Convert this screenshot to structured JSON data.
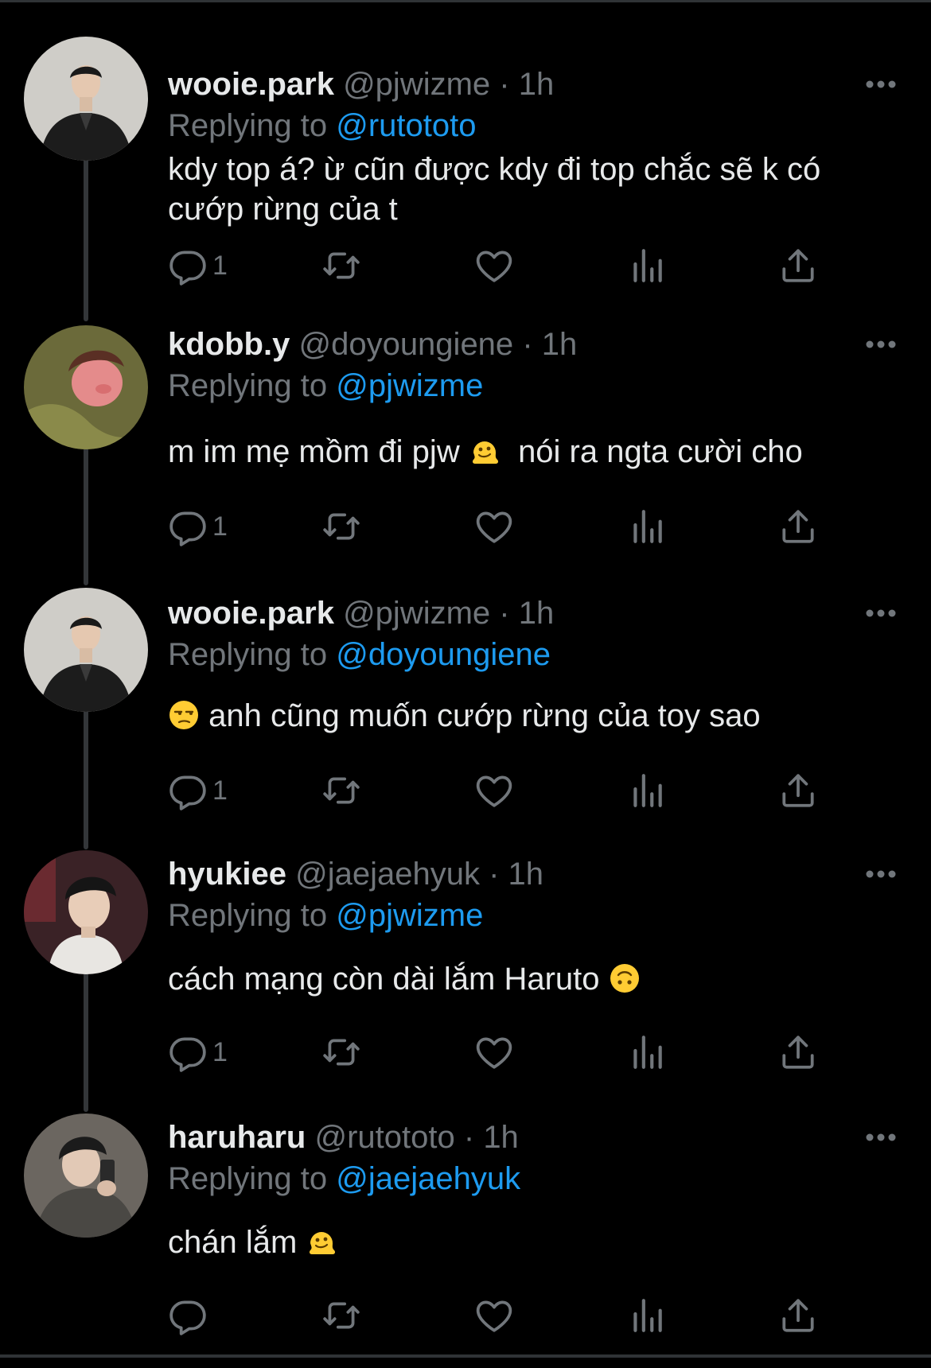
{
  "colors": {
    "background": "#000000",
    "text": "#e7e9ea",
    "muted": "#71767b",
    "link": "#1d9bf0",
    "thread_line": "#333639"
  },
  "labels": {
    "replying_to": "Replying to",
    "separator": "·"
  },
  "tweets": [
    {
      "name": "wooie.park",
      "handle": "@pjwizme",
      "time": "1h",
      "replying_to": "@rutototo",
      "text_lines": [
        "kdy top á? ừ cũn được kdy đi top chắc sẽ k có",
        "cướp rừng của t"
      ],
      "reply_count": "1",
      "icons": [
        "reply-icon",
        "retweet-icon",
        "like-icon",
        "views-icon",
        "share-icon",
        "more-icon"
      ]
    },
    {
      "name": "kdobb.y",
      "handle": "@doyoungiene",
      "time": "1h",
      "replying_to": "@pjwizme",
      "text_before": "m im mẹ mồm đi pjw",
      "emoji": "melting-face-emoji",
      "text_after": "nói ra ngta cười cho",
      "reply_count": "1"
    },
    {
      "name": "wooie.park",
      "handle": "@pjwizme",
      "time": "1h",
      "replying_to": "@doyoungiene",
      "emoji": "unamused-face-emoji",
      "text_after": "anh cũng muốn cướp rừng của toy sao",
      "reply_count": "1"
    },
    {
      "name": "hyukiee",
      "handle": "@jaejaehyuk",
      "time": "1h",
      "replying_to": "@pjwizme",
      "text_before": "cách mạng còn dài lắm Haruto",
      "emoji": "upside-down-face-emoji",
      "reply_count": "1"
    },
    {
      "name": "haruharu",
      "handle": "@rutototo",
      "time": "1h",
      "replying_to": "@jaejaehyuk",
      "text_before": "chán lắm",
      "emoji": "melting-face-emoji",
      "reply_count": ""
    }
  ]
}
